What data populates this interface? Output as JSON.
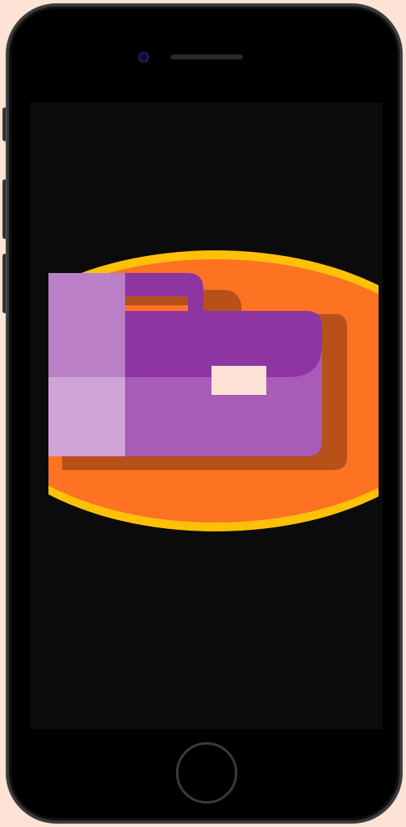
{
  "device": {
    "type": "smartphone",
    "colors": {
      "page_background": "#fde3d6",
      "phone_frame": "#000000",
      "screen_background": "#0b0b0b"
    }
  },
  "screen": {
    "content": {
      "icon": "briefcase-icon",
      "colors": {
        "badge_outer": "#ffc107",
        "badge_inner": "#fd7322",
        "briefcase_main": "#a85bb7",
        "briefcase_dark": "#8e35a3",
        "briefcase_light": "#ba7fc6",
        "briefcase_lightest": "#cfa3d6",
        "shadow": "#b8501a",
        "clasp": "#fde0d6"
      }
    }
  }
}
